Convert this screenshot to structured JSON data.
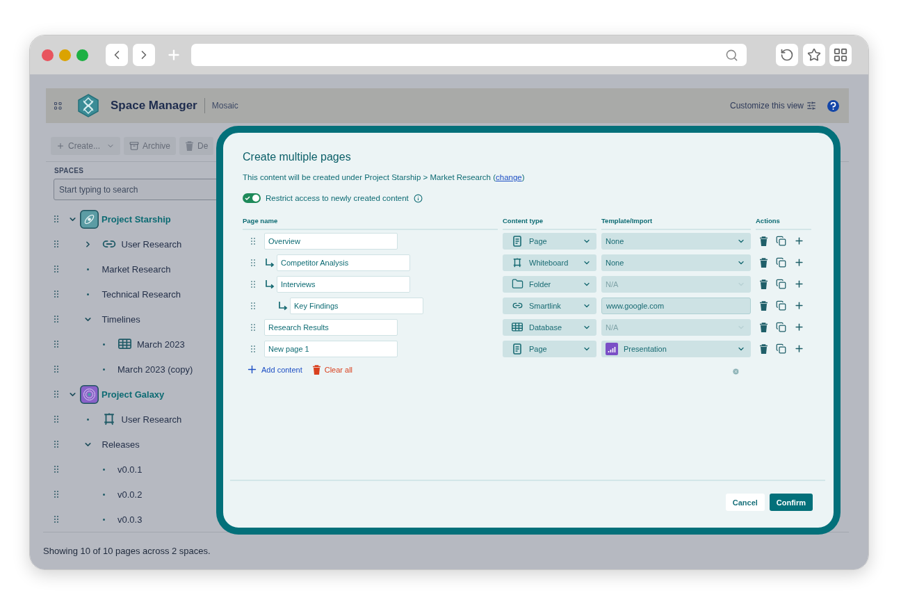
{
  "header": {
    "title": "Space Manager",
    "workspace": "Mosaic",
    "customize": "Customize this view"
  },
  "toolbar": [
    {
      "label": "Create...",
      "kind": "create"
    },
    {
      "label": "Archive",
      "kind": "archive"
    },
    {
      "label": "De",
      "kind": "delete"
    }
  ],
  "sidebar": {
    "heading": "SPACES",
    "search": {
      "placeholder": "Start typing to search"
    },
    "tree": [
      {
        "label": "Project Starship",
        "kind": "space",
        "color": "#5c9ca4",
        "expanded": true,
        "children": [
          {
            "label": "User Research",
            "kind": "link",
            "expanded": false
          },
          {
            "label": "Market Research",
            "kind": "page"
          },
          {
            "label": "Technical Research",
            "kind": "page"
          },
          {
            "label": "Timelines",
            "kind": "page",
            "expanded": true,
            "children": [
              {
                "label": "March 2023",
                "kind": "database"
              },
              {
                "label": "March 2023 (copy)",
                "kind": "page"
              }
            ]
          }
        ]
      },
      {
        "label": "Project Galaxy",
        "kind": "space",
        "color": "#8a62c9",
        "expanded": true,
        "children": [
          {
            "label": "User Research",
            "kind": "whiteboard"
          },
          {
            "label": "Releases",
            "kind": "page",
            "expanded": true,
            "children": [
              {
                "label": "v0.0.1",
                "kind": "page"
              },
              {
                "label": "v0.0.2",
                "kind": "page"
              },
              {
                "label": "v0.0.3",
                "kind": "page"
              }
            ]
          }
        ]
      }
    ]
  },
  "status_bar": "Showing 10 of 10 pages across 2 spaces.",
  "dialog": {
    "title": "Create multiple pages",
    "location_prefix": "This content will be created under Project Starship > Market Research (",
    "change_link": "change",
    "location_suffix": ")",
    "restrict": {
      "label": "Restrict access to newly created content",
      "on": true
    },
    "columns": [
      "Page name",
      "Content type",
      "Template/Import",
      "Actions"
    ],
    "rows": [
      {
        "name": "Overview",
        "type": "Page",
        "kind": "page",
        "template": {
          "value": "None",
          "kind": "select",
          "disabled": false
        },
        "children": [
          {
            "name": "Competitor Analysis",
            "type": "Whiteboard",
            "kind": "whiteboard",
            "template": {
              "value": "None",
              "kind": "select",
              "disabled": false
            }
          },
          {
            "name": "Interviews",
            "type": "Folder",
            "kind": "folder",
            "template": {
              "value": "N/A",
              "kind": "select",
              "disabled": true
            },
            "children": [
              {
                "name": "Key Findings",
                "type": "Smartlink",
                "kind": "link",
                "template": {
                  "value": "www.google.com",
                  "kind": "input"
                }
              }
            ]
          }
        ]
      },
      {
        "name": "Research Results",
        "type": "Database",
        "kind": "database",
        "template": {
          "value": "N/A",
          "kind": "select",
          "disabled": true
        }
      },
      {
        "name": "New page 1",
        "type": "Page",
        "kind": "page",
        "template": {
          "value": "Presentation",
          "kind": "template",
          "disabled": false
        }
      }
    ],
    "add_label": "Add content",
    "clear_label": "Clear all",
    "buttons": [
      {
        "label": "Cancel",
        "kind": "secondary"
      },
      {
        "label": "Confirm",
        "kind": "primary"
      }
    ]
  }
}
